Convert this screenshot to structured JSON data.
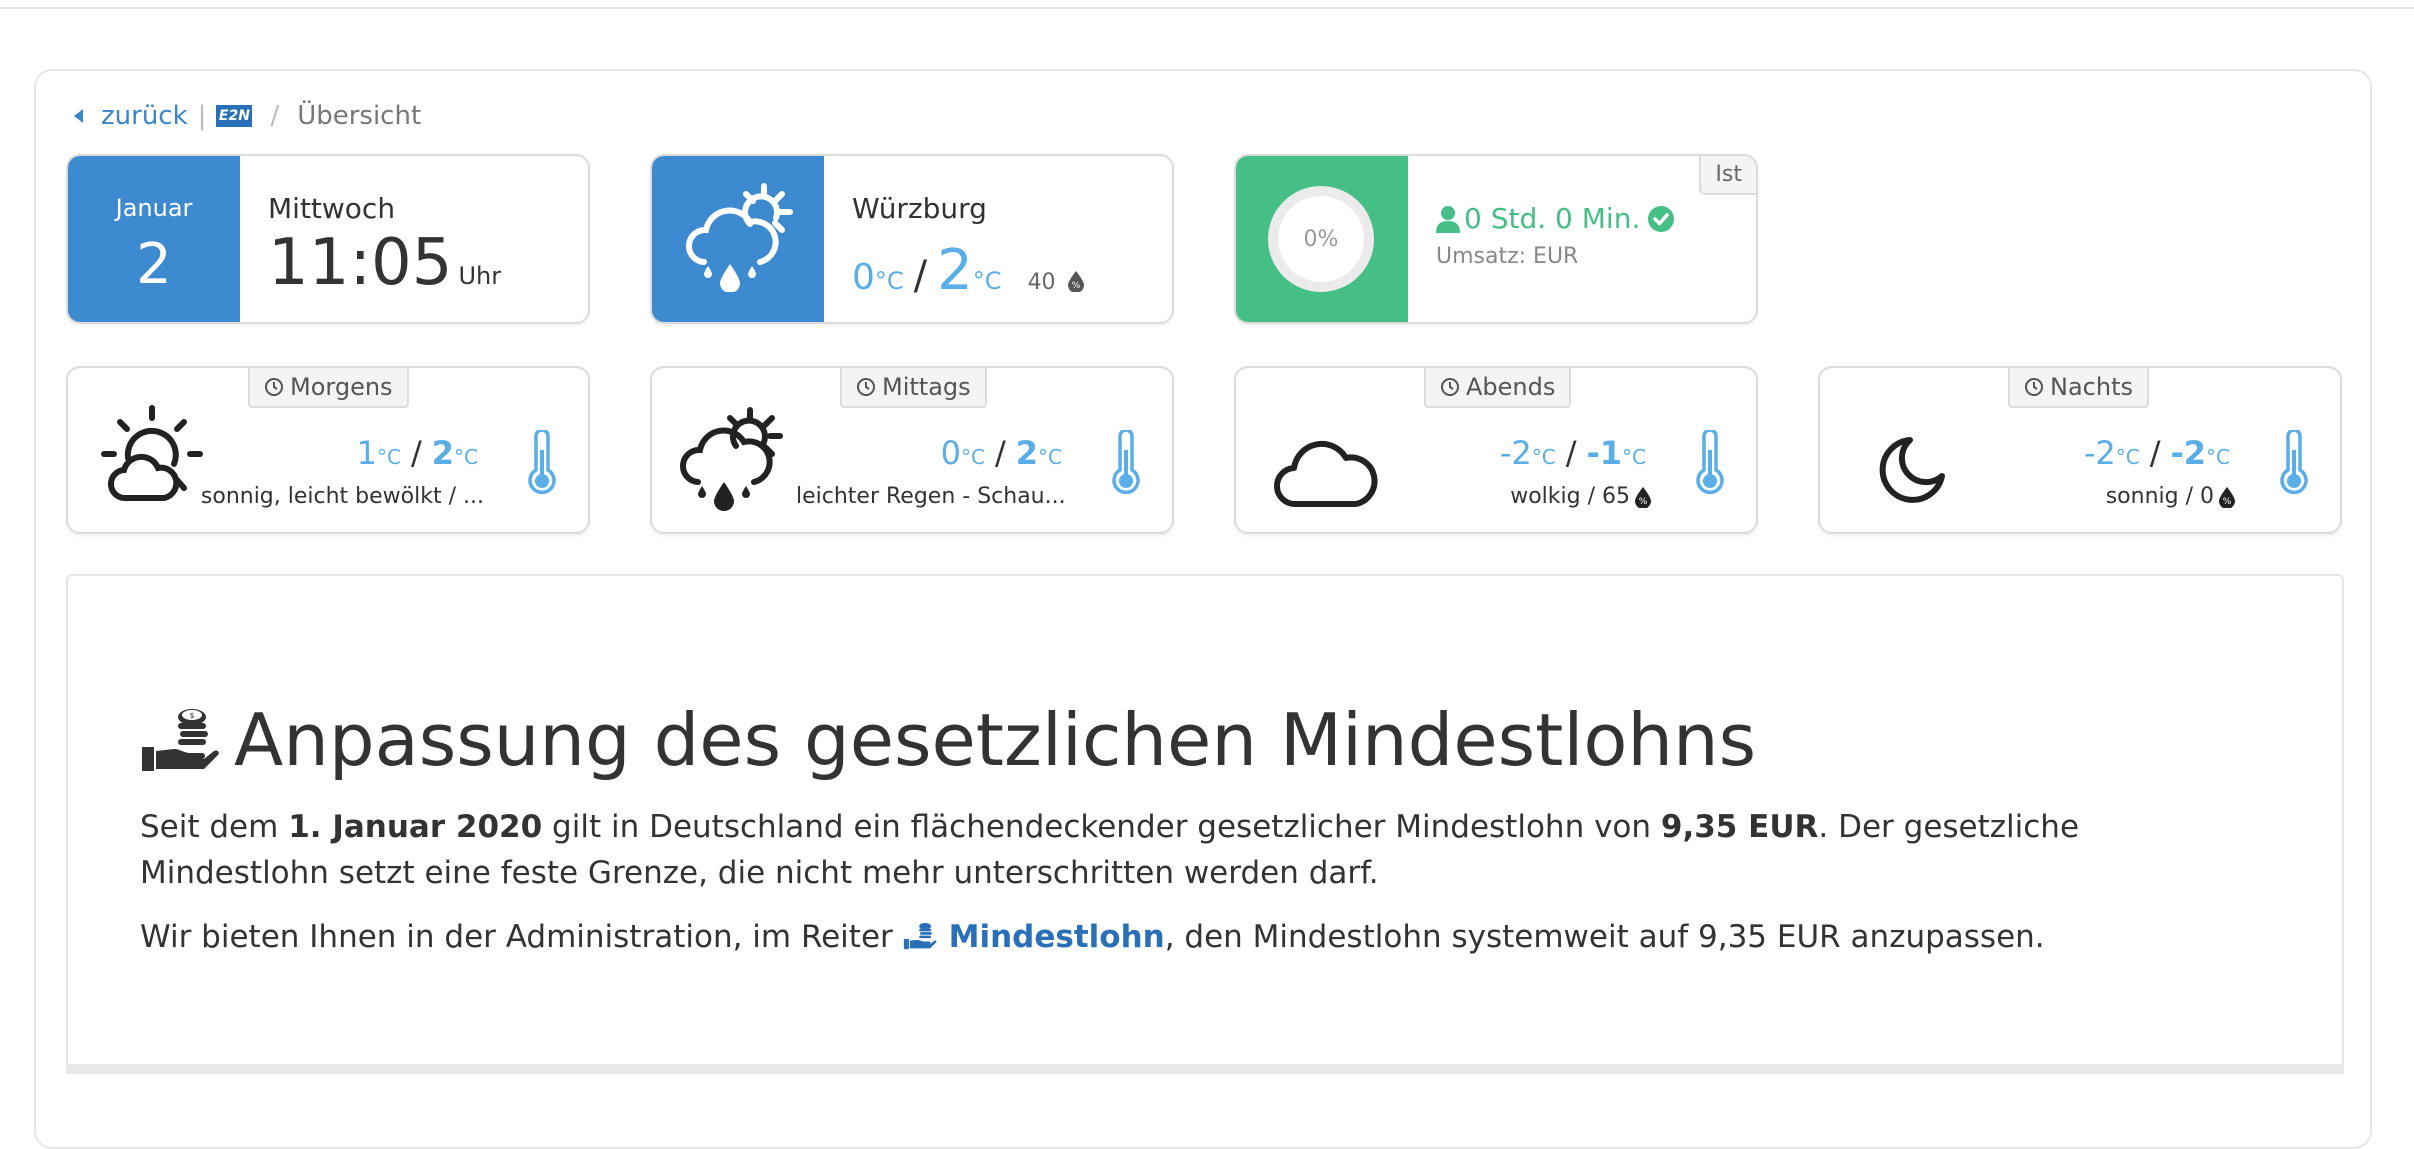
{
  "breadcrumb": {
    "back_label": "zurück",
    "logo_text": "E2N",
    "current": "Übersicht"
  },
  "date_card": {
    "month": "Januar",
    "day": "2",
    "weekday": "Mittwoch",
    "time": "11:05",
    "time_suffix": "Uhr"
  },
  "weather_card": {
    "city": "Würzburg",
    "temp_low": "0",
    "temp_high": "2",
    "unit": "°C",
    "humidity": "40",
    "icon": "cloud-sun-rain-icon"
  },
  "work_card": {
    "progress_label": "0%",
    "progress": 0,
    "hours_text": "0 Std. 0 Min.",
    "revenue_text": "Umsatz: EUR",
    "tag": "Ist"
  },
  "forecast": [
    {
      "period": "Morgens",
      "low": "1",
      "high": "2",
      "unit": "°C",
      "desc": "sonnig, leicht bewölkt / ...",
      "icon": "sun-cloud-icon"
    },
    {
      "period": "Mittags",
      "low": "0",
      "high": "2",
      "unit": "°C",
      "desc": "leichter Regen - Schau...",
      "icon": "cloud-sun-rain-icon"
    },
    {
      "period": "Abends",
      "low": "-2",
      "high": "-1",
      "unit": "°C",
      "desc": "wolkig / 65",
      "icon": "cloud-icon"
    },
    {
      "period": "Nachts",
      "low": "-2",
      "high": "-2",
      "unit": "°C",
      "desc": "sonnig / 0",
      "icon": "moon-icon"
    }
  ],
  "info": {
    "title": "Anpassung des gesetzlichen Mindestlohns",
    "p1_pre": "Seit dem ",
    "p1_bold1": "1. Januar 2020",
    "p1_mid": " gilt in Deutschland ein flächendeckender gesetzlicher Mindestlohn von ",
    "p1_bold2": "9,35 EUR",
    "p1_post": ". Der gesetzliche Mindestlohn setzt eine feste Grenze, die nicht mehr unterschritten werden darf.",
    "p2_pre": "Wir bieten Ihnen in der Administration, im Reiter ",
    "p2_link": "Mindestlohn",
    "p2_post": ", den Mindestlohn systemweit auf 9,35 EUR anzupassen."
  },
  "colors": {
    "accent_blue": "#3d8ad0",
    "accent_green": "#46bf86",
    "temp_blue": "#5aaee8"
  }
}
